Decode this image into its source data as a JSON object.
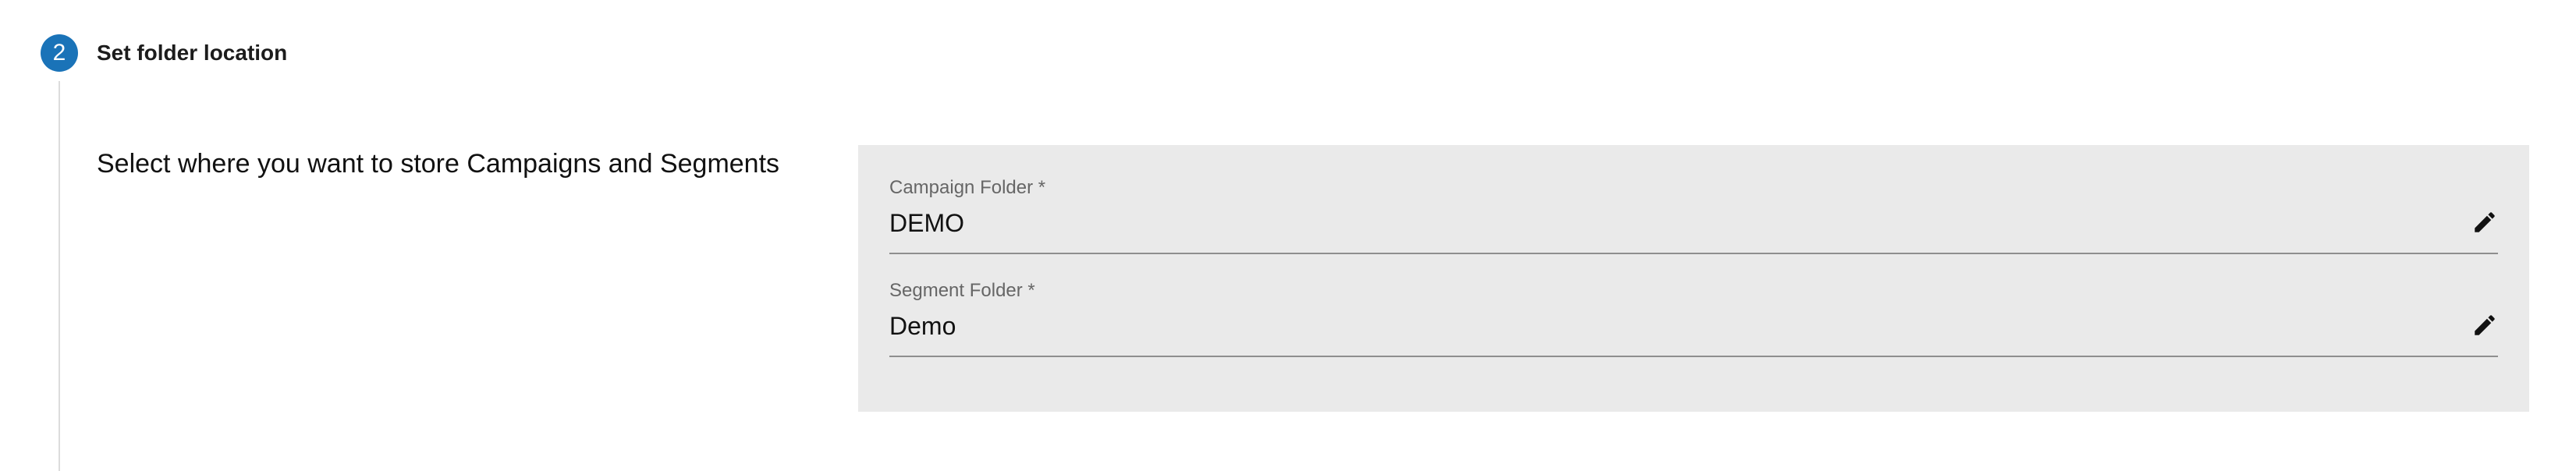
{
  "step": {
    "number": "2",
    "title": "Set folder location"
  },
  "section": {
    "description": "Select where you want to store Campaigns and Segments"
  },
  "fields": {
    "campaign_folder": {
      "label": "Campaign Folder *",
      "value": "DEMO",
      "icon": "pencil-icon"
    },
    "segment_folder": {
      "label": "Segment Folder *",
      "value": "Demo",
      "icon": "pencil-icon"
    }
  },
  "colors": {
    "accent": "#1a73b8",
    "panel_background": "#eaeaea",
    "rail": "#dcdcdc"
  }
}
